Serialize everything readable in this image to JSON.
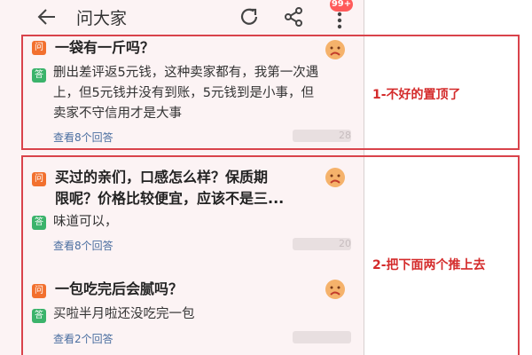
{
  "header": {
    "title": "问大家",
    "badge": "99+"
  },
  "questions": [
    {
      "q_tag": "问",
      "question": "一袋有一斤吗？",
      "a_tag": "答",
      "answer_lines": [
        "删出差评返5元钱，这种卖家都有，我第一次遇",
        "上，但5元钱并没有到账，5元钱到是小事，但",
        "卖家不守信用才是大事"
      ],
      "more": "查看8个回答",
      "blurred_suffix": "28"
    },
    {
      "q_tag": "问",
      "question_lines": [
        "买过的亲们，口感怎么样？保质期",
        "限呢？价格比较便宜，应该不是三..."
      ],
      "a_tag": "答",
      "answer": "味道可以，",
      "more": "查看8个回答",
      "blurred_suffix": "20"
    },
    {
      "q_tag": "问",
      "question": "一包吃完后会腻吗？",
      "a_tag": "答",
      "answer": "买啦半月啦还没吃完一包",
      "more": "查看2个回答"
    }
  ],
  "annotations": {
    "first": "1-不好的置顶了",
    "second": "2-把下面两个推上去"
  },
  "colors": {
    "accent_red": "#d9434b",
    "ask_tag": "#f2702e",
    "answer_tag": "#3bb36b",
    "link": "#4a6ea0"
  }
}
